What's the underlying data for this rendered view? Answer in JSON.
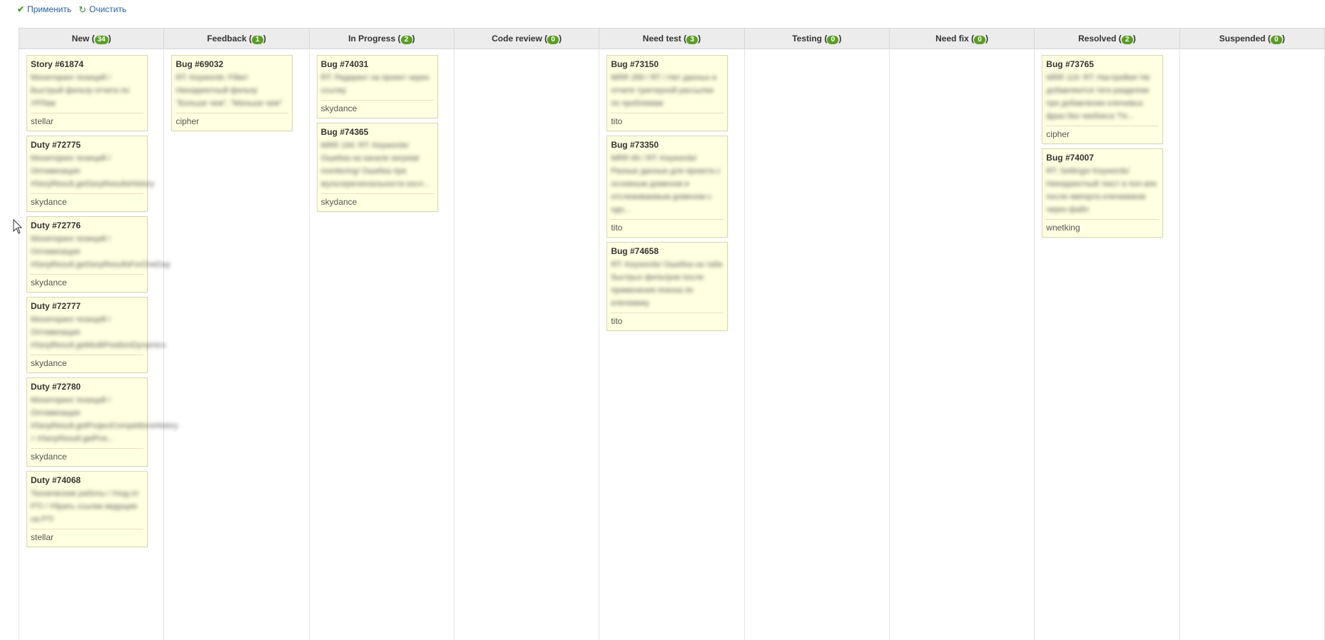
{
  "toolbar": {
    "apply_label": "Применить",
    "clear_label": "Очистить"
  },
  "columns": [
    {
      "name": "New",
      "count": "34",
      "cards": [
        {
          "id": "Story #61874",
          "subject": "Мониторинг позиций / Быстрый фильтр отчета по УРЛам",
          "assignee": "stellar"
        },
        {
          "id": "Duty #72775",
          "subject": "Мониторинг позиций / Оптимизация #SerpResult.getSerpResultsHistory",
          "assignee": "skydance"
        },
        {
          "id": "Duty #72776",
          "subject": "Мониторинг позиций / Оптимизация #SerpResult.getSerpResultsForOneDay",
          "assignee": "skydance"
        },
        {
          "id": "Duty #72777",
          "subject": "Мониторинг позиций / Оптимизация #SerpResult.getMultiPositionDynamics",
          "assignee": "skydance"
        },
        {
          "id": "Duty #72780",
          "subject": "Мониторинг позиций / Оптимизация #SerpResult.getProjectCompetitorsHistory + #SerpResult.getPos...",
          "assignee": "skydance"
        },
        {
          "id": "Duty #74068",
          "subject": "Технические работы / Уход от PTI / Убрать ссылки ведущие на PTI",
          "assignee": "stellar"
        }
      ]
    },
    {
      "name": "Feedback",
      "count": "1",
      "cards": [
        {
          "id": "Bug #69032",
          "subject": "RT: Keywords: Filter/ Некорректный фильтр \"Больше чем\", \"Меньше чем\"",
          "assignee": "cipher"
        }
      ]
    },
    {
      "name": "In Progress",
      "count": "2",
      "cards": [
        {
          "id": "Bug #74031",
          "subject": "RT: Редирект на проект через ссылку",
          "assignee": "skydance"
        },
        {
          "id": "Bug #74365",
          "subject": "MRR 194: RT: Keywords/ Ошибка на канале serpstat monitoring/ Ошибка при мультирегиональности косл...",
          "assignee": "skydance"
        }
      ]
    },
    {
      "name": "Code review",
      "count": "0",
      "cards": []
    },
    {
      "name": "Need test",
      "count": "3",
      "cards": [
        {
          "id": "Bug #73150",
          "subject": "MRR 289 / RT / Нет данных в отчете триггерной рассылки по проблемам",
          "assignee": "tito"
        },
        {
          "id": "Bug #73350",
          "subject": "MRR 69 / RT: Keywords/ Разные данные для проекта с основным доменом и отслеживаемым доменом с одн...",
          "assignee": "tito"
        },
        {
          "id": "Bug #74658",
          "subject": "RT: Keywords/ Ошибка на табе быстрых фильтров после применения поиска по ключевику",
          "assignee": "tito"
        }
      ]
    },
    {
      "name": "Testing",
      "count": "0",
      "cards": []
    },
    {
      "name": "Need fix",
      "count": "0",
      "cards": []
    },
    {
      "name": "Resolved",
      "count": "2",
      "cards": [
        {
          "id": "Bug #73765",
          "subject": "MRR 119: RT: Настройки/ Не добавляются теги разделом при добавлении ключевых фраз без чекбокса \"Ге...",
          "assignee": "cipher"
        },
        {
          "id": "Bug #74007",
          "subject": "RT: Settings/ Keywords/ Некорректный текст в поп-апе после импорта ключевиков через файл",
          "assignee": "wnetking"
        }
      ]
    },
    {
      "name": "Suspended",
      "count": "0",
      "cards": []
    }
  ]
}
